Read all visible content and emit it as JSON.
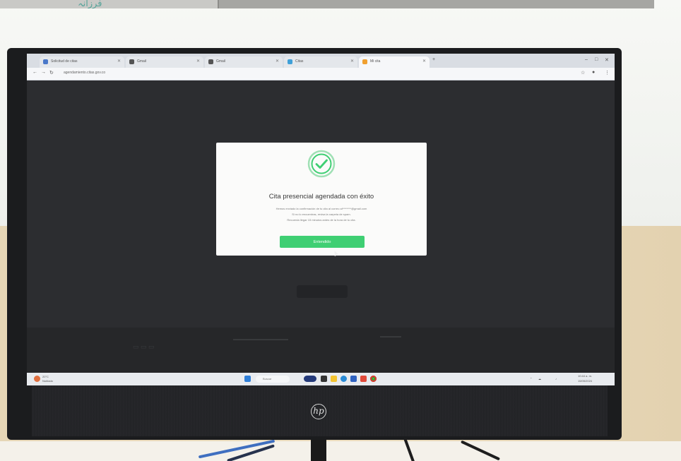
{
  "browser": {
    "tabs": [
      {
        "label": "Solicitud de citas",
        "active": false
      },
      {
        "label": "Gmail",
        "active": false
      },
      {
        "label": "Gmail",
        "active": false
      },
      {
        "label": "Citas",
        "active": false
      },
      {
        "label": "Mi cita",
        "active": true
      }
    ],
    "url": "agendamiento.citas.gov.co",
    "add_tab": "+"
  },
  "modal": {
    "title": "Cita presencial agendada con éxito",
    "line1": "Hemos enviado la confirmación de tu cita al correo al********@gmail.com",
    "line2": "Si no lo encuentras, revisa la carpeta de spam.",
    "line3": "Recuerda llegar 15 minutos antes de la hora de tu cita.",
    "button_label": "Entendido",
    "accent_color": "#3fcf73"
  },
  "taskbar": {
    "weather": "20°C",
    "weather_sub": "Nublado",
    "search_placeholder": "Buscar",
    "time": "10:44 a. m.",
    "date": "15/05/2024"
  },
  "device": {
    "brand": "hp"
  }
}
